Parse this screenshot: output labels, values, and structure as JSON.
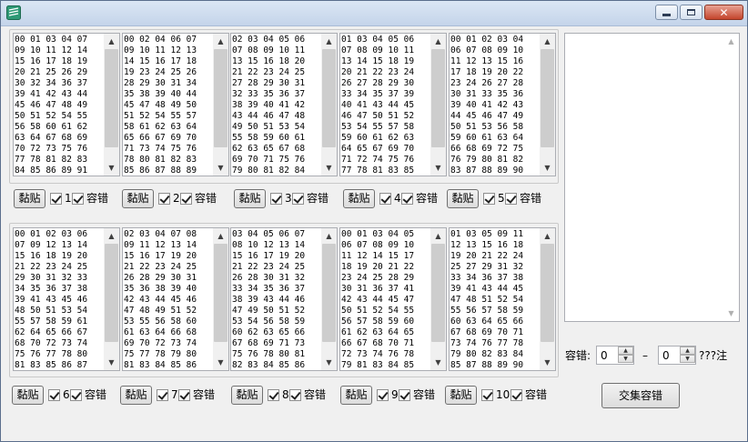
{
  "groups": [
    {
      "id": 1,
      "rows": [
        "00 01 03 04 07",
        "09 10 11 12 14",
        "15 16 17 18 19",
        "20 21 25 26 29",
        "30 32 34 36 37",
        "39 41 42 43 44",
        "45 46 47 48 49",
        "50 51 52 54 55",
        "56 58 60 61 62",
        "63 64 67 68 69",
        "70 72 73 75 76",
        "77 78 81 82 83",
        "84 85 86 89 91"
      ],
      "paste_label": "黏贴",
      "number": "1",
      "label": "容错"
    },
    {
      "id": 2,
      "rows": [
        "00 02 04 06 07",
        "09 10 11 12 13",
        "14 15 16 17 18",
        "19 23 24 25 26",
        "28 29 30 31 34",
        "35 38 39 40 44",
        "45 47 48 49 50",
        "51 52 54 55 57",
        "58 61 62 63 64",
        "65 66 67 69 70",
        "71 73 74 75 76",
        "78 80 81 82 83",
        "85 86 87 88 89"
      ],
      "paste_label": "黏贴",
      "number": "2",
      "label": "容错"
    },
    {
      "id": 3,
      "rows": [
        "02 03 04 05 06",
        "07 08 09 10 11",
        "13 15 16 18 20",
        "21 22 23 24 25",
        "27 28 29 30 31",
        "32 33 35 36 37",
        "38 39 40 41 42",
        "43 44 46 47 48",
        "49 50 51 53 54",
        "55 58 59 60 61",
        "62 63 65 67 68",
        "69 70 71 75 76",
        "79 80 81 82 84"
      ],
      "paste_label": "黏贴",
      "number": "3",
      "label": "容错"
    },
    {
      "id": 4,
      "rows": [
        "01 03 04 05 06",
        "07 08 09 10 11",
        "13 14 15 18 19",
        "20 21 22 23 24",
        "26 27 28 29 30",
        "33 34 35 37 39",
        "40 41 43 44 45",
        "46 47 50 51 52",
        "53 54 55 57 58",
        "59 60 61 62 63",
        "64 65 67 69 70",
        "71 72 74 75 76",
        "77 78 81 83 85"
      ],
      "paste_label": "黏贴",
      "number": "4",
      "label": "容错"
    },
    {
      "id": 5,
      "rows": [
        "00 01 02 03 04",
        "06 07 08 09 10",
        "11 12 13 15 16",
        "17 18 19 20 22",
        "23 24 26 27 28",
        "30 31 33 35 36",
        "39 40 41 42 43",
        "44 45 46 47 49",
        "50 51 53 56 58",
        "59 60 61 63 64",
        "66 68 69 72 75",
        "76 79 80 81 82",
        "83 87 88 89 90"
      ],
      "paste_label": "黏贴",
      "number": "5",
      "label": "容错"
    },
    {
      "id": 6,
      "rows": [
        "00 01 02 03 06",
        "07 09 12 13 14",
        "15 16 18 19 20",
        "21 22 23 24 25",
        "29 30 31 32 33",
        "34 35 36 37 38",
        "39 41 43 45 46",
        "48 50 51 53 54",
        "55 57 58 59 61",
        "62 64 65 66 67",
        "68 70 72 73 74",
        "75 76 77 78 80",
        "81 83 85 86 87"
      ],
      "paste_label": "黏贴",
      "number": "6",
      "label": "容错"
    },
    {
      "id": 7,
      "rows": [
        "02 03 04 07 08",
        "09 11 12 13 14",
        "15 16 17 19 20",
        "21 22 23 24 25",
        "26 28 29 30 31",
        "35 36 38 39 40",
        "42 43 44 45 46",
        "47 48 49 51 52",
        "53 55 56 58 60",
        "61 63 64 66 68",
        "69 70 72 73 74",
        "75 77 78 79 80",
        "81 83 84 85 86"
      ],
      "paste_label": "黏贴",
      "number": "7",
      "label": "容错"
    },
    {
      "id": 8,
      "rows": [
        "03 04 05 06 07",
        "08 10 12 13 14",
        "15 16 17 19 20",
        "21 22 23 24 25",
        "26 28 30 31 32",
        "33 34 35 36 37",
        "38 39 43 44 46",
        "47 49 50 51 52",
        "53 54 56 58 59",
        "60 62 63 65 66",
        "67 68 69 71 73",
        "75 76 78 80 81",
        "82 83 84 85 86"
      ],
      "paste_label": "黏贴",
      "number": "8",
      "label": "容错"
    },
    {
      "id": 9,
      "rows": [
        "00 01 03 04 05",
        "06 07 08 09 10",
        "11 12 14 15 17",
        "18 19 20 21 22",
        "23 24 25 28 29",
        "30 31 36 37 41",
        "42 43 44 45 47",
        "50 51 52 54 55",
        "56 57 58 59 60",
        "61 62 63 64 65",
        "66 67 68 70 71",
        "72 73 74 76 78",
        "79 81 83 84 85"
      ],
      "paste_label": "黏贴",
      "number": "9",
      "label": "容错"
    },
    {
      "id": 10,
      "rows": [
        "01 03 05 09 11",
        "12 13 15 16 18",
        "19 20 21 22 24",
        "25 27 29 31 32",
        "33 34 36 37 38",
        "39 41 43 44 45",
        "47 48 51 52 54",
        "55 56 57 58 59",
        "60 63 64 65 66",
        "67 68 69 70 71",
        "73 74 76 77 78",
        "79 80 82 83 84",
        "85 87 88 89 90"
      ],
      "paste_label": "黏贴",
      "number": "10",
      "label": "容错"
    }
  ],
  "tolerance": {
    "label": "容错:",
    "min": "0",
    "dash": "–",
    "max": "0",
    "suffix": "???注"
  },
  "intersect_button": "交集容错",
  "scroll_up": "▲",
  "scroll_down": "▼",
  "spin_up": "▲",
  "spin_down": "▼",
  "close_glyph": "✕"
}
